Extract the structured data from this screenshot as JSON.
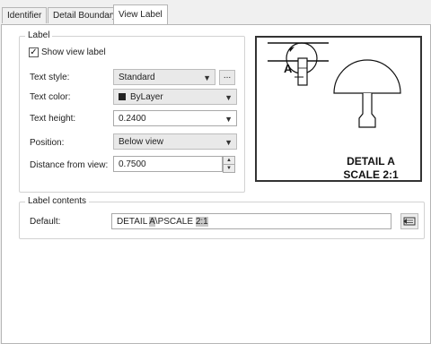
{
  "tabs": [
    {
      "label": "Identifier"
    },
    {
      "label": "Detail Boundary"
    },
    {
      "label": "View Label",
      "active": true
    }
  ],
  "label_group": {
    "title": "Label",
    "show_view_label": {
      "label": "Show view label",
      "checked": true
    },
    "text_style": {
      "label": "Text style:",
      "value": "Standard"
    },
    "text_color": {
      "label": "Text color:",
      "value": "ByLayer",
      "swatch": "#222222"
    },
    "text_height": {
      "label": "Text height:",
      "value": "0.2400"
    },
    "position": {
      "label": "Position:",
      "value": "Below view"
    },
    "distance": {
      "label": "Distance from view:",
      "value": "0.7500"
    },
    "browse_button": "..."
  },
  "preview": {
    "marker": "A",
    "caption_line1": "DETAIL A",
    "caption_line2": "SCALE 2:1"
  },
  "contents_group": {
    "title": "Label contents",
    "default_label": "Default:",
    "default_segments": [
      "DETAIL ",
      "A",
      "\\PSCALE ",
      "2:1"
    ]
  }
}
